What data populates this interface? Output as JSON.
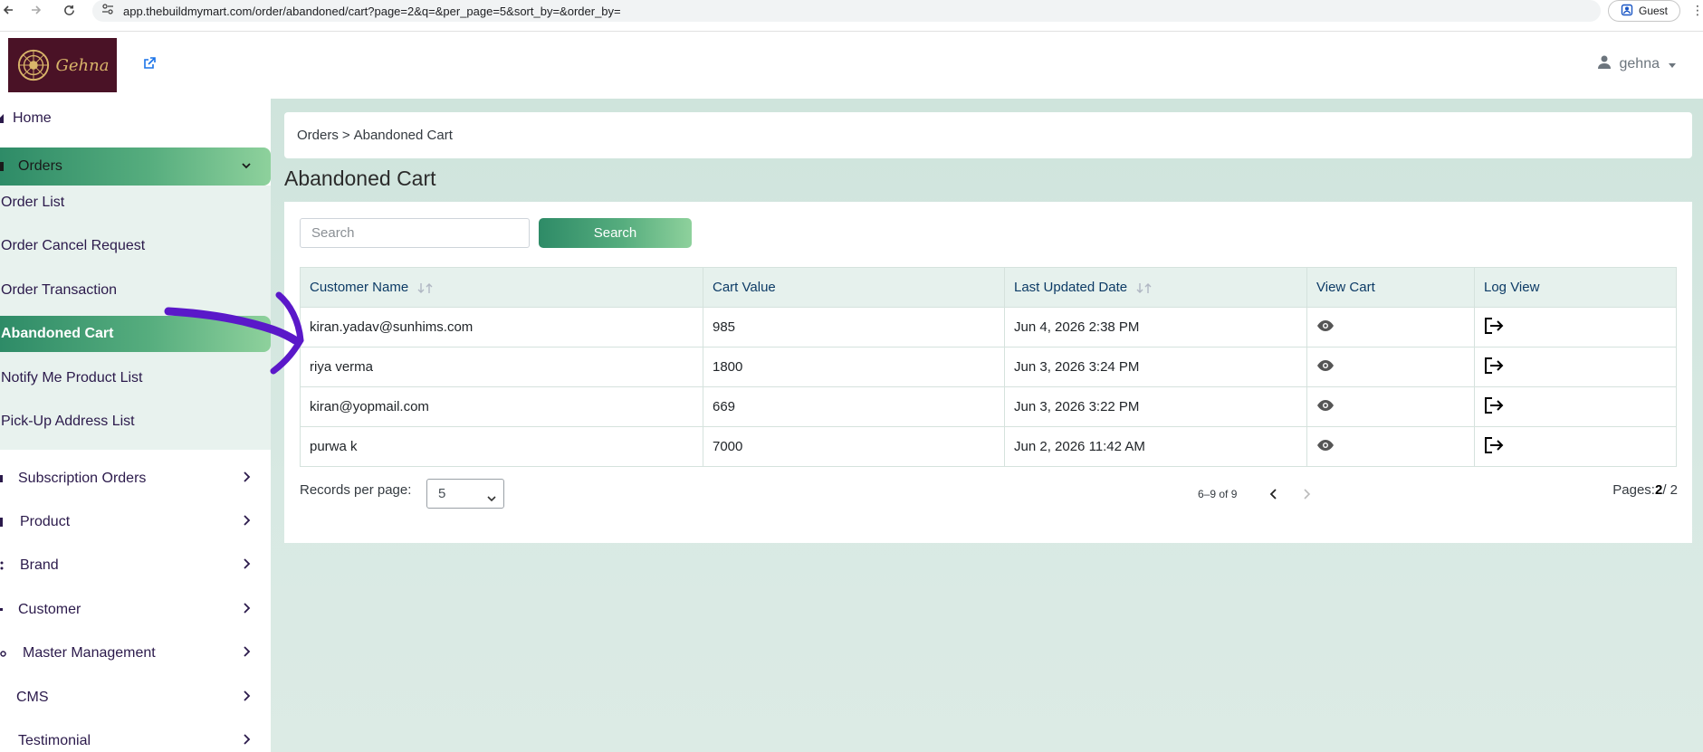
{
  "browser": {
    "url": "app.thebuildmymart.com/order/abandoned/cart?page=2&q=&per_page=5&sort_by=&order_by=",
    "profile_label": "Guest"
  },
  "header": {
    "logo_text": "Gehna",
    "user_name": "gehna"
  },
  "sidebar": {
    "home": "Home",
    "orders": "Orders",
    "order_submenu": [
      "Order List",
      "Order Cancel Request",
      "Order Transaction",
      "Abandoned Cart",
      "Notify Me Product List",
      "Pick-Up Address List"
    ],
    "sections": [
      "Subscription Orders",
      "Product",
      "Brand",
      "Customer",
      "Master Management",
      "CMS",
      "Testimonial"
    ]
  },
  "breadcrumb": {
    "parent": "Orders",
    "separator": ">",
    "current": "Abandoned Cart"
  },
  "page_title": "Abandoned Cart",
  "search": {
    "placeholder": "Search",
    "value": "",
    "button_label": "Search"
  },
  "table": {
    "headers": [
      "Customer Name",
      "Cart Value",
      "Last Updated Date",
      "View Cart",
      "Log View"
    ],
    "rows": [
      {
        "customer": "kiran.yadav@sunhims.com",
        "value": "985",
        "date": "Jun 4, 2026 2:38 PM"
      },
      {
        "customer": "riya verma",
        "value": "1800",
        "date": "Jun 3, 2026 3:24 PM"
      },
      {
        "customer": "kiran@yopmail.com",
        "value": "669",
        "date": "Jun 3, 2026 3:22 PM"
      },
      {
        "customer": "purwa k",
        "value": "7000",
        "date": "Jun 2, 2026 11:42 AM"
      }
    ]
  },
  "pagination": {
    "records_label": "Records per page:",
    "per_page": "5",
    "range": "6–9 of 9",
    "pages_label": "Pages:",
    "current_page": "2",
    "total_pages": "/ 2"
  },
  "icons": {
    "view_cart": "eye-icon",
    "log_view": "logout-icon",
    "annotation": "purple-hand-drawn-arrow"
  },
  "colors": {
    "accent_gradient_start": "#2e8b67",
    "accent_gradient_end": "#8ed19c",
    "annotation": "#5a18c9"
  }
}
